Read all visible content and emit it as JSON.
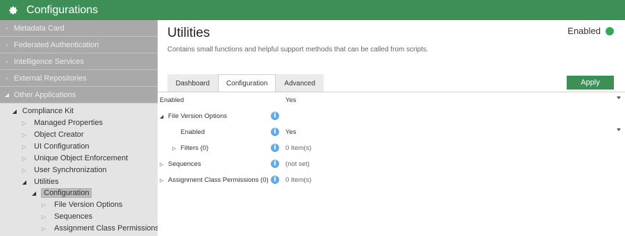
{
  "app": {
    "title": "Configurations",
    "icon": "gear-icon"
  },
  "sidebar": {
    "groups": [
      {
        "label": "Metadata Card"
      },
      {
        "label": "Federated Authentication"
      },
      {
        "label": "Intelligence Services"
      },
      {
        "label": "External Repositories"
      },
      {
        "label": "Other Applications"
      }
    ],
    "tree": {
      "compliance_kit": "Compliance Kit",
      "managed_properties": "Managed Properties",
      "object_creator": "Object Creator",
      "ui_configuration": "UI Configuration",
      "unique_object_enforcement": "Unique Object Enforcement",
      "user_synchronization": "User Synchronization",
      "utilities": "Utilities",
      "configuration": "Configuration",
      "file_version_options": "File Version Options",
      "sequences": "Sequences",
      "assignment_class_permissions": "Assignment Class Permissions ("
    }
  },
  "header": {
    "title": "Utilities",
    "description": "Contains small functions and helpful support methods that can be called from scripts.",
    "status_label": "Enabled",
    "status_color": "#3aa55a"
  },
  "tabs": [
    {
      "label": "Dashboard"
    },
    {
      "label": "Configuration"
    },
    {
      "label": "Advanced"
    }
  ],
  "active_tab": "Configuration",
  "apply_label": "Apply",
  "grid": {
    "enabled": {
      "label": "Enabled",
      "value": "Yes"
    },
    "file_version_options": {
      "label": "File Version Options"
    },
    "fvo_enabled": {
      "label": "Enabled",
      "value": "Yes"
    },
    "filters": {
      "label": "Filters (0)",
      "value": "0 Item(s)"
    },
    "sequences": {
      "label": "Sequences",
      "value": "(not set)"
    },
    "assignment": {
      "label": "Assignment Class Permissions (0)",
      "value": "0 Item(s)"
    }
  },
  "colors": {
    "accent": "#3e8e57",
    "sidebar_group": "#a9a9a9",
    "info": "#6aa9dc"
  }
}
